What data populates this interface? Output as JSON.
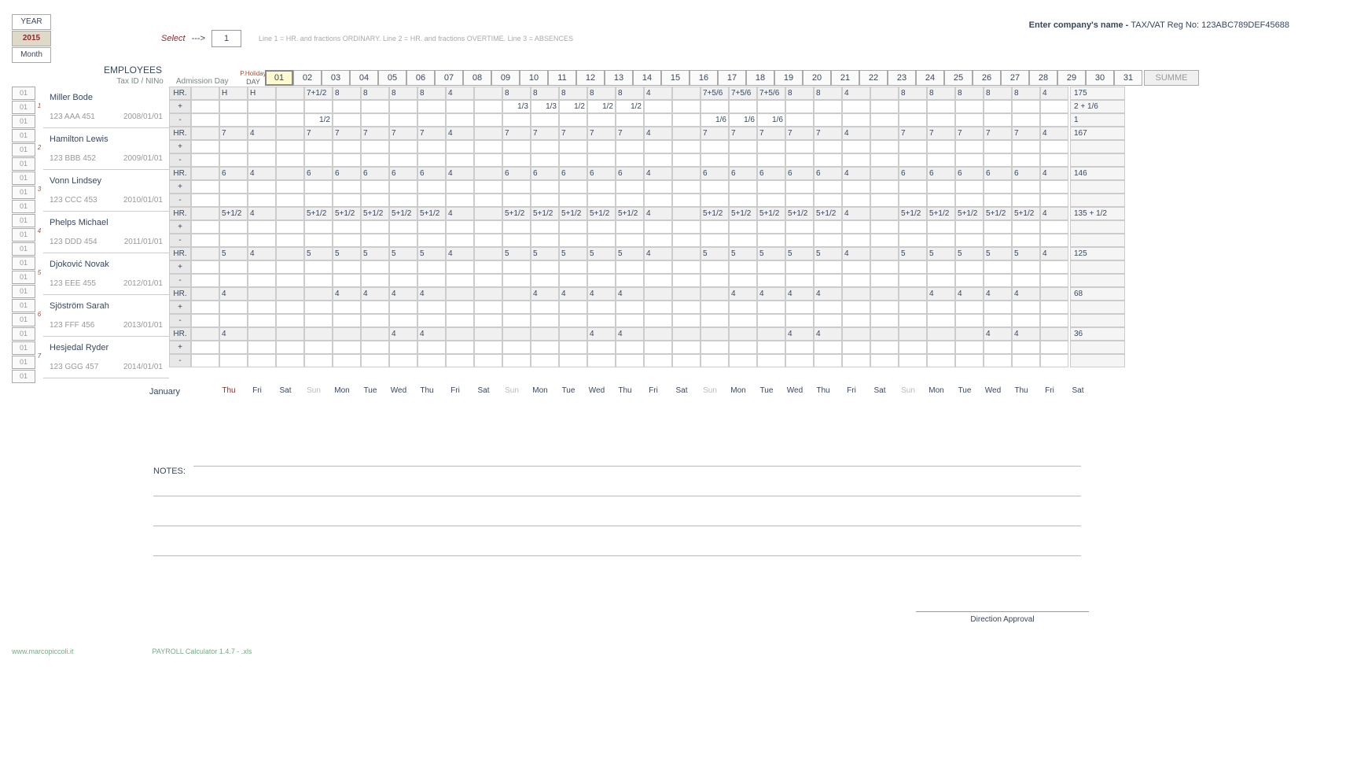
{
  "header": {
    "year_label": "YEAR",
    "year": "2015",
    "month_label": "Month",
    "select_label": "Select",
    "select_arrow": "--->",
    "select_value": "1",
    "legend": "Line 1 = HR. and fractions ORDINARY.    Line 2 = HR. and fractions OVERTIME.    Line 3 = ABSENCES",
    "company_prefix": "Enter company's name   -   ",
    "tax_label": "TAX/VAT Reg No: ",
    "tax_value": "123ABC789DEF45688",
    "employees_title": "EMPLOYEES",
    "taxid_label": "Tax ID / NINo",
    "admission_label": "Admission Day",
    "day_label": "DAY",
    "pholiday": "P.Holiday",
    "summe": "SUMME"
  },
  "days": [
    "01",
    "02",
    "03",
    "04",
    "05",
    "06",
    "07",
    "08",
    "09",
    "10",
    "11",
    "12",
    "13",
    "14",
    "15",
    "16",
    "17",
    "18",
    "19",
    "20",
    "21",
    "22",
    "23",
    "24",
    "25",
    "26",
    "27",
    "28",
    "29",
    "30",
    "31"
  ],
  "weekdays": [
    "Thu",
    "Fri",
    "Sat",
    "Sun",
    "Mon",
    "Tue",
    "Wed",
    "Thu",
    "Fri",
    "Sat",
    "Sun",
    "Mon",
    "Tue",
    "Wed",
    "Thu",
    "Fri",
    "Sat",
    "Sun",
    "Mon",
    "Tue",
    "Wed",
    "Thu",
    "Fri",
    "Sat",
    "Sun",
    "Mon",
    "Tue",
    "Wed",
    "Thu",
    "Fri",
    "Sat"
  ],
  "month_name": "January",
  "left_labels": "01",
  "row_labels": [
    "HR.",
    "+",
    "-"
  ],
  "employees": [
    {
      "idx": "1",
      "name": "Miller Bode",
      "taxid": "123 AAA 451",
      "admission": "2008/01/01",
      "hr": [
        "",
        "H",
        "H",
        "",
        "7+1/2",
        "8",
        "8",
        "8",
        "8",
        "4",
        "",
        "8",
        "8",
        "8",
        "8",
        "8",
        "4",
        "",
        "7+5/6",
        "7+5/6",
        "7+5/6",
        "8",
        "8",
        "4",
        "",
        "8",
        "8",
        "8",
        "8",
        "8",
        "4"
      ],
      "plus": [
        "",
        "",
        "",
        "",
        "",
        "",
        "",
        "",
        "",
        "",
        "",
        "1/3",
        "1/3",
        "1/2",
        "1/2",
        "1/2",
        "",
        "",
        "",
        "",
        "",
        "",
        "",
        "",
        "",
        "",
        "",
        "",
        "",
        "",
        ""
      ],
      "minus": [
        "",
        "",
        "",
        "",
        "1/2",
        "",
        "",
        "",
        "",
        "",
        "",
        "",
        "",
        "",
        "",
        "",
        "",
        "",
        "1/6",
        "1/6",
        "1/6",
        "",
        "",
        "",
        "",
        "",
        "",
        "",
        "",
        "",
        ""
      ],
      "sum": [
        "175",
        "2 + 1/6",
        "1"
      ]
    },
    {
      "idx": "2",
      "name": "Hamilton Lewis",
      "taxid": "123 BBB 452",
      "admission": "2009/01/01",
      "hr": [
        "",
        "7",
        "4",
        "",
        "7",
        "7",
        "7",
        "7",
        "7",
        "4",
        "",
        "7",
        "7",
        "7",
        "7",
        "7",
        "4",
        "",
        "7",
        "7",
        "7",
        "7",
        "7",
        "4",
        "",
        "7",
        "7",
        "7",
        "7",
        "7",
        "4"
      ],
      "plus": [
        "",
        "",
        "",
        "",
        "",
        "",
        "",
        "",
        "",
        "",
        "",
        "",
        "",
        "",
        "",
        "",
        "",
        "",
        "",
        "",
        "",
        "",
        "",
        "",
        "",
        "",
        "",
        "",
        "",
        "",
        ""
      ],
      "minus": [
        "",
        "",
        "",
        "",
        "",
        "",
        "",
        "",
        "",
        "",
        "",
        "",
        "",
        "",
        "",
        "",
        "",
        "",
        "",
        "",
        "",
        "",
        "",
        "",
        "",
        "",
        "",
        "",
        "",
        "",
        ""
      ],
      "sum": [
        "167",
        "",
        ""
      ]
    },
    {
      "idx": "3",
      "name": "Vonn Lindsey",
      "taxid": "123 CCC 453",
      "admission": "2010/01/01",
      "hr": [
        "",
        "6",
        "4",
        "",
        "6",
        "6",
        "6",
        "6",
        "6",
        "4",
        "",
        "6",
        "6",
        "6",
        "6",
        "6",
        "4",
        "",
        "6",
        "6",
        "6",
        "6",
        "6",
        "4",
        "",
        "6",
        "6",
        "6",
        "6",
        "6",
        "4"
      ],
      "plus": [
        "",
        "",
        "",
        "",
        "",
        "",
        "",
        "",
        "",
        "",
        "",
        "",
        "",
        "",
        "",
        "",
        "",
        "",
        "",
        "",
        "",
        "",
        "",
        "",
        "",
        "",
        "",
        "",
        "",
        "",
        ""
      ],
      "minus": [
        "",
        "",
        "",
        "",
        "",
        "",
        "",
        "",
        "",
        "",
        "",
        "",
        "",
        "",
        "",
        "",
        "",
        "",
        "",
        "",
        "",
        "",
        "",
        "",
        "",
        "",
        "",
        "",
        "",
        "",
        ""
      ],
      "sum": [
        "146",
        "",
        ""
      ]
    },
    {
      "idx": "4",
      "name": "Phelps Michael",
      "taxid": "123 DDD 454",
      "admission": "2011/01/01",
      "hr": [
        "",
        "5+1/2",
        "4",
        "",
        "5+1/2",
        "5+1/2",
        "5+1/2",
        "5+1/2",
        "5+1/2",
        "4",
        "",
        "5+1/2",
        "5+1/2",
        "5+1/2",
        "5+1/2",
        "5+1/2",
        "4",
        "",
        "5+1/2",
        "5+1/2",
        "5+1/2",
        "5+1/2",
        "5+1/2",
        "4",
        "",
        "5+1/2",
        "5+1/2",
        "5+1/2",
        "5+1/2",
        "5+1/2",
        "4"
      ],
      "plus": [
        "",
        "",
        "",
        "",
        "",
        "",
        "",
        "",
        "",
        "",
        "",
        "",
        "",
        "",
        "",
        "",
        "",
        "",
        "",
        "",
        "",
        "",
        "",
        "",
        "",
        "",
        "",
        "",
        "",
        "",
        ""
      ],
      "minus": [
        "",
        "",
        "",
        "",
        "",
        "",
        "",
        "",
        "",
        "",
        "",
        "",
        "",
        "",
        "",
        "",
        "",
        "",
        "",
        "",
        "",
        "",
        "",
        "",
        "",
        "",
        "",
        "",
        "",
        "",
        ""
      ],
      "sum": [
        "135 + 1/2",
        "",
        ""
      ]
    },
    {
      "idx": "5",
      "name": "Djoković Novak",
      "taxid": "123 EEE 455",
      "admission": "2012/01/01",
      "hr": [
        "",
        "5",
        "4",
        "",
        "5",
        "5",
        "5",
        "5",
        "5",
        "4",
        "",
        "5",
        "5",
        "5",
        "5",
        "5",
        "4",
        "",
        "5",
        "5",
        "5",
        "5",
        "5",
        "4",
        "",
        "5",
        "5",
        "5",
        "5",
        "5",
        "4"
      ],
      "plus": [
        "",
        "",
        "",
        "",
        "",
        "",
        "",
        "",
        "",
        "",
        "",
        "",
        "",
        "",
        "",
        "",
        "",
        "",
        "",
        "",
        "",
        "",
        "",
        "",
        "",
        "",
        "",
        "",
        "",
        "",
        ""
      ],
      "minus": [
        "",
        "",
        "",
        "",
        "",
        "",
        "",
        "",
        "",
        "",
        "",
        "",
        "",
        "",
        "",
        "",
        "",
        "",
        "",
        "",
        "",
        "",
        "",
        "",
        "",
        "",
        "",
        "",
        "",
        "",
        ""
      ],
      "sum": [
        "125",
        "",
        ""
      ]
    },
    {
      "idx": "6",
      "name": "Sjöström Sarah",
      "taxid": "123 FFF 456",
      "admission": "2013/01/01",
      "hr": [
        "",
        "4",
        "",
        "",
        "",
        "4",
        "4",
        "4",
        "4",
        "",
        "",
        "",
        "4",
        "4",
        "4",
        "4",
        "",
        "",
        "",
        "4",
        "4",
        "4",
        "4",
        "",
        "",
        "",
        "4",
        "4",
        "4",
        "4",
        ""
      ],
      "plus": [
        "",
        "",
        "",
        "",
        "",
        "",
        "",
        "",
        "",
        "",
        "",
        "",
        "",
        "",
        "",
        "",
        "",
        "",
        "",
        "",
        "",
        "",
        "",
        "",
        "",
        "",
        "",
        "",
        "",
        "",
        ""
      ],
      "minus": [
        "",
        "",
        "",
        "",
        "",
        "",
        "",
        "",
        "",
        "",
        "",
        "",
        "",
        "",
        "",
        "",
        "",
        "",
        "",
        "",
        "",
        "",
        "",
        "",
        "",
        "",
        "",
        "",
        "",
        "",
        ""
      ],
      "sum": [
        "68",
        "",
        ""
      ]
    },
    {
      "idx": "7",
      "name": "Hesjedal Ryder",
      "taxid": "123 GGG 457",
      "admission": "2014/01/01",
      "hr": [
        "",
        "4",
        "",
        "",
        "",
        "",
        "",
        "4",
        "4",
        "",
        "",
        "",
        "",
        "",
        "4",
        "4",
        "",
        "",
        "",
        "",
        "",
        "4",
        "4",
        "",
        "",
        "",
        "",
        "",
        "4",
        "4",
        ""
      ],
      "plus": [
        "",
        "",
        "",
        "",
        "",
        "",
        "",
        "",
        "",
        "",
        "",
        "",
        "",
        "",
        "",
        "",
        "",
        "",
        "",
        "",
        "",
        "",
        "",
        "",
        "",
        "",
        "",
        "",
        "",
        "",
        ""
      ],
      "minus": [
        "",
        "",
        "",
        "",
        "",
        "",
        "",
        "",
        "",
        "",
        "",
        "",
        "",
        "",
        "",
        "",
        "",
        "",
        "",
        "",
        "",
        "",
        "",
        "",
        "",
        "",
        "",
        "",
        "",
        "",
        ""
      ],
      "sum": [
        "36",
        "",
        ""
      ]
    }
  ],
  "notes_label": "NOTES:",
  "approval": "Direction Approval",
  "footer": {
    "site": "www.marcopiccoli.it",
    "app": "PAYROLL Calculator 1.4.7  -  .xls"
  }
}
